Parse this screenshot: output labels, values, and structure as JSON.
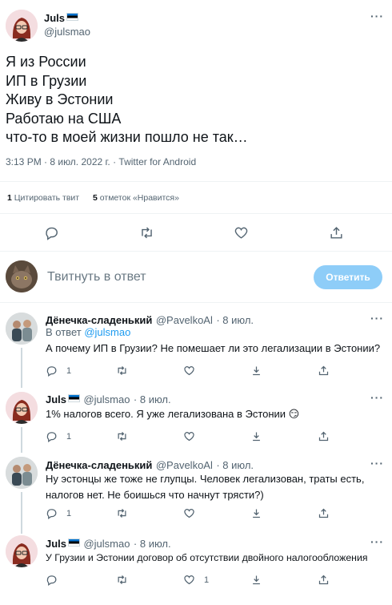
{
  "tweet": {
    "author_name": "Juls",
    "author_handle": "@julsmao",
    "lines": [
      "Я из России",
      "ИП в Грузии",
      "Живу в Эстонии",
      "Работаю на США",
      "что-то в моей жизни пошло не так…"
    ],
    "meta": "3:13 PM · 8 июл. 2022 г. · Twitter for Android",
    "quote_count": "1",
    "quote_label": "Цитировать твит",
    "like_count": "5",
    "like_label": "отметок «Нравится»"
  },
  "composer": {
    "placeholder": "Твитнуть в ответ",
    "button": "Ответить"
  },
  "replies": [
    {
      "name": "Дёнечка-сладенький",
      "handle": "@PavelkoAl",
      "date": "· 8 июл.",
      "reply_to_prefix": "В ответ",
      "reply_to": "@julsmao",
      "text": "А почему ИП в Грузии? Не помешает ли это легализации в Эстонии?",
      "reply_count": "1",
      "retweet_count": "",
      "like_count": ""
    },
    {
      "name": "Juls",
      "handle": "@julsmao",
      "date": "· 8 июл.",
      "text": "1% налогов всего. Я уже легализована в Эстонии 😏",
      "reply_count": "1",
      "retweet_count": "",
      "like_count": ""
    },
    {
      "name": "Дёнечка-сладенький",
      "handle": "@PavelkoAl",
      "date": "· 8 июл.",
      "text_lines": [
        "Ну эстонцы же тоже не глупцы. Человек легализован, траты есть,",
        "налогов нет. Не боишься что начнут трясти?)"
      ],
      "reply_count": "1",
      "retweet_count": "",
      "like_count": ""
    },
    {
      "name": "Juls",
      "handle": "@julsmao",
      "date": "· 8 июл.",
      "text": "У Грузии и Эстонии договор об отсутствии двойного налогообложения",
      "reply_count": "",
      "retweet_count": "",
      "like_count": "1"
    }
  ],
  "colors": {
    "accent": "#1d9bf0",
    "button_disabled": "#8ecdf8",
    "text": "#0f1419",
    "muted": "#536471"
  }
}
